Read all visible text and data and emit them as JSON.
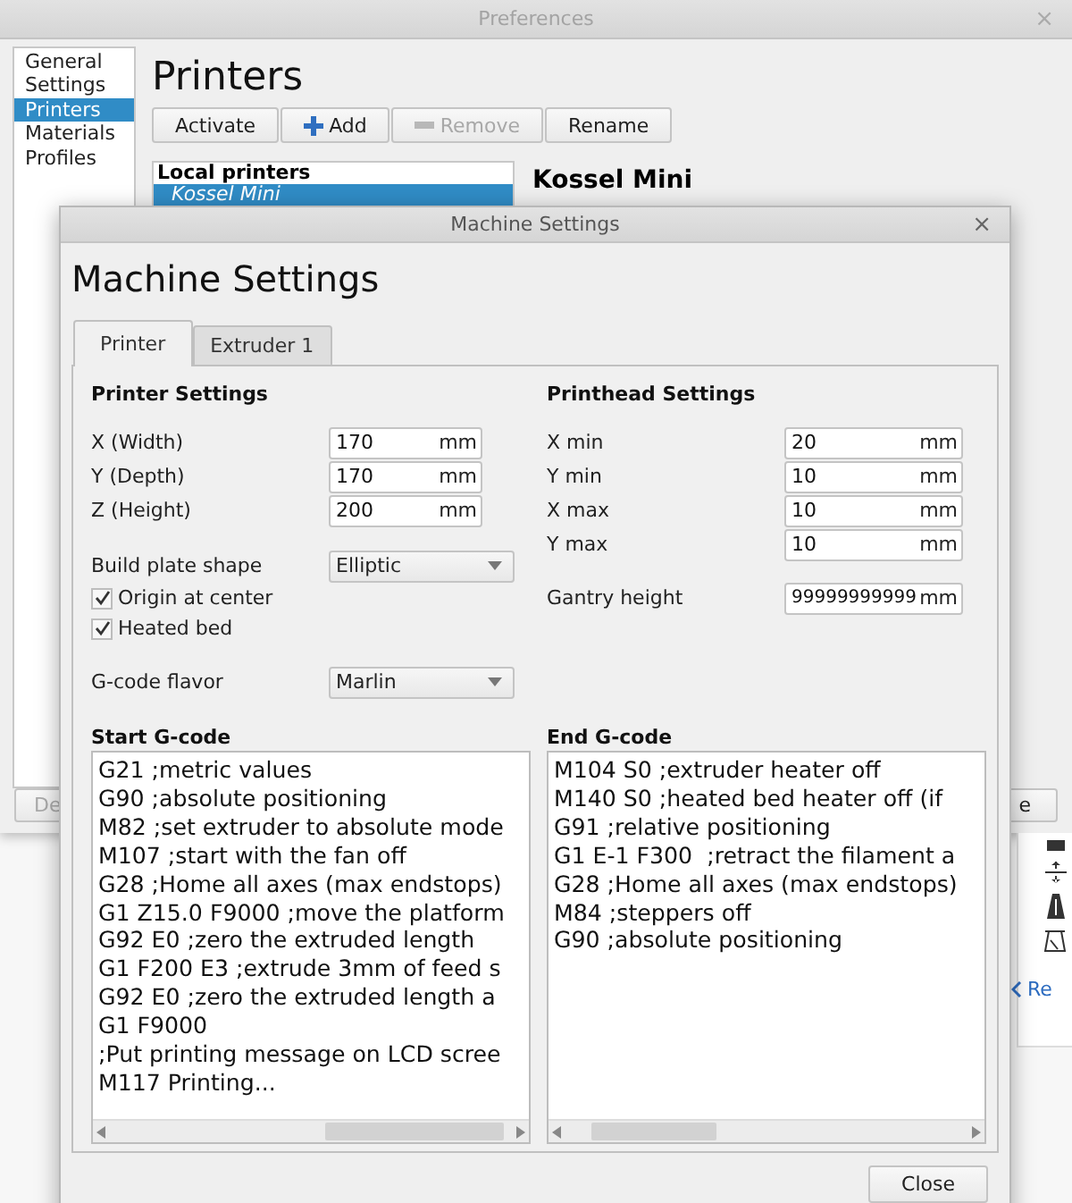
{
  "preferences": {
    "title": "Preferences",
    "close": "×",
    "sidebar": [
      {
        "label": "General Settings",
        "selected": false
      },
      {
        "label": "Printers",
        "selected": true
      },
      {
        "label": "Materials",
        "selected": false
      },
      {
        "label": "Profiles",
        "selected": false
      }
    ],
    "heading": "Printers",
    "buttons": [
      {
        "label": "Activate",
        "disabled": false
      },
      {
        "label": "Add",
        "disabled": false
      },
      {
        "label": "Remove",
        "disabled": true
      },
      {
        "label": "Rename",
        "disabled": false
      }
    ],
    "printer_list": {
      "header": "Local printers",
      "items": [
        {
          "label": "Kossel Mini",
          "selected": true
        }
      ]
    },
    "printer_name": "Kossel Mini",
    "bottom_buttons": [
      {
        "label": "De",
        "disabled": true
      },
      {
        "label": "e",
        "disabled": false
      }
    ]
  },
  "side_panel": {
    "link": "Re"
  },
  "dialog": {
    "title": "Machine Settings",
    "close": "×",
    "heading": "Machine Settings",
    "tabs": [
      {
        "label": "Printer",
        "selected": true
      },
      {
        "label": "Extruder 1",
        "selected": false
      }
    ],
    "printer_settings": {
      "title": "Printer Settings",
      "fields": [
        {
          "label": "X (Width)",
          "value": "170",
          "unit": "mm"
        },
        {
          "label": "Y (Depth)",
          "value": "170",
          "unit": "mm"
        },
        {
          "label": "Z (Height)",
          "value": "200",
          "unit": "mm"
        }
      ],
      "build_plate": {
        "label": "Build plate shape",
        "value": "Elliptic"
      },
      "checkboxes": [
        {
          "label": "Origin at center",
          "checked": true
        },
        {
          "label": "Heated bed",
          "checked": true
        }
      ],
      "gcode_flavor": {
        "label": "G-code flavor",
        "value": "Marlin"
      }
    },
    "printhead_settings": {
      "title": "Printhead Settings",
      "fields": [
        {
          "label": "X min",
          "value": "20",
          "unit": "mm"
        },
        {
          "label": "Y min",
          "value": "10",
          "unit": "mm"
        },
        {
          "label": "X max",
          "value": "10",
          "unit": "mm"
        },
        {
          "label": "Y max",
          "value": "10",
          "unit": "mm"
        }
      ],
      "gantry": {
        "label": "Gantry height",
        "value": "99999999999",
        "unit": "mm"
      }
    },
    "start_gcode": {
      "title": "Start G-code",
      "lines": [
        "G21 ;metric values",
        "G90 ;absolute positioning",
        "M82 ;set extruder to absolute mode",
        "M107 ;start with the fan off",
        "G28 ;Home all axes (max endstops)",
        "G1 Z15.0 F9000 ;move the platform",
        "G92 E0 ;zero the extruded length",
        "G1 F200 E3 ;extrude 3mm of feed s",
        "G92 E0 ;zero the extruded length a",
        "G1 F9000",
        ";Put printing message on LCD scree",
        "M117 Printing..."
      ]
    },
    "end_gcode": {
      "title": "End G-code",
      "lines": [
        "M104 S0 ;extruder heater off",
        "M140 S0 ;heated bed heater off (if",
        "G91 ;relative positioning",
        "G1 E-1 F300  ;retract the filament a",
        "G28 ;Home all axes (max endstops)",
        "M84 ;steppers off",
        "G90 ;absolute positioning"
      ]
    },
    "close_button": "Close"
  }
}
